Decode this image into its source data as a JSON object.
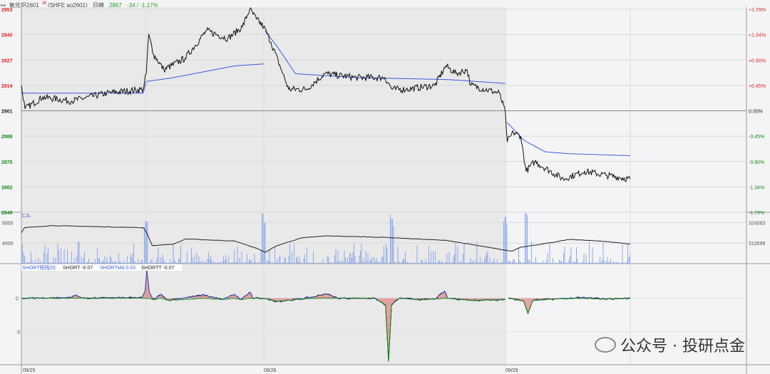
{
  "header": {
    "link_icon": "link-icon",
    "title": "氧化铝2601",
    "superscript": "M",
    "exchange": "(SHFE ao2601)",
    "period": "日線",
    "price": "2867",
    "change": "-34 / -1.17%"
  },
  "volume_pane": {
    "label": "CJL",
    "left_ticks": [
      "8000",
      "4000"
    ],
    "right_ticks": [
      "324083",
      "313599"
    ]
  },
  "indicator_pane": {
    "name": "SHORT短线(5)",
    "short": "SHORT -0.07",
    "shortma": "SHORTMA 0.03",
    "shortt": "SHORTT -0.07",
    "ticks": [
      "0",
      "-5"
    ]
  },
  "dates": [
    "09/25",
    "09/26",
    "09/29"
  ],
  "watermark": "公众号 · 投研点金",
  "colors": {
    "up": "#e02020",
    "down": "#1a8a1a",
    "vwap": "#3b5bdb",
    "price": "#111111",
    "volume": "#8fa8e8"
  },
  "chart_data": {
    "type": "line",
    "title": "氧化铝2601 intraday",
    "ylim": [
      2849,
      2953
    ],
    "left_ticks": [
      "2953",
      "2940",
      "2927",
      "2914",
      "2901",
      "2888",
      "2875",
      "2862",
      "2849"
    ],
    "right_ticks": [
      "+1.79%",
      "+1.34%",
      "+0.90%",
      "+0.45%",
      "0.00%",
      "-0.45%",
      "-0.90%",
      "-1.34%",
      "-1.79%"
    ],
    "prev_close": 2901,
    "price": [
      [
        0,
        2914
      ],
      [
        0.6,
        2902
      ],
      [
        3.5,
        2908
      ],
      [
        8.2,
        2906
      ],
      [
        14,
        2910
      ],
      [
        20,
        2912
      ],
      [
        20.5,
        2920
      ],
      [
        20.9,
        2940
      ],
      [
        21.7,
        2930
      ],
      [
        23.4,
        2922
      ],
      [
        26.9,
        2928
      ],
      [
        30.4,
        2942
      ],
      [
        33.9,
        2938
      ],
      [
        36.3,
        2944
      ],
      [
        37.5,
        2953
      ],
      [
        38.6,
        2948
      ],
      [
        39.8,
        2944
      ],
      [
        41,
        2936
      ],
      [
        42.7,
        2922
      ],
      [
        43.9,
        2912
      ],
      [
        46.8,
        2912
      ],
      [
        49.8,
        2920
      ],
      [
        55,
        2918
      ],
      [
        59.7,
        2918
      ],
      [
        60.9,
        2912
      ],
      [
        63.2,
        2912
      ],
      [
        67.9,
        2914
      ],
      [
        69.7,
        2924
      ],
      [
        71.4,
        2920
      ],
      [
        73.2,
        2922
      ],
      [
        73.8,
        2914
      ],
      [
        78.5,
        2910
      ],
      [
        79.5,
        2900
      ],
      [
        79.8,
        2885
      ],
      [
        80.8,
        2890
      ],
      [
        82,
        2888
      ],
      [
        82.9,
        2870
      ],
      [
        84.3,
        2875
      ],
      [
        89,
        2866
      ],
      [
        92.5,
        2870
      ],
      [
        96,
        2868
      ],
      [
        100,
        2866
      ]
    ],
    "vwap": [
      [
        [
          0,
          2910
        ],
        [
          20,
          2910
        ],
        [
          20.5,
          2916
        ],
        [
          25,
          2918
        ],
        [
          35,
          2924
        ],
        [
          39.8,
          2925
        ]
      ],
      [
        [
          40,
          2942
        ],
        [
          42,
          2934
        ],
        [
          45,
          2920
        ],
        [
          55,
          2918
        ],
        [
          70,
          2917
        ],
        [
          79.5,
          2915
        ]
      ],
      [
        [
          79.8,
          2895
        ],
        [
          82.5,
          2886
        ],
        [
          86,
          2880
        ],
        [
          90,
          2879
        ],
        [
          100,
          2878
        ]
      ]
    ],
    "oi": [
      [
        0,
        6000
      ],
      [
        0.5,
        7000
      ],
      [
        5,
        7400
      ],
      [
        20,
        7000
      ],
      [
        20.6,
        6000
      ],
      [
        21.5,
        3500
      ],
      [
        25,
        3800
      ],
      [
        27,
        4800
      ],
      [
        35,
        4400
      ],
      [
        38.6,
        3000
      ],
      [
        40,
        2200
      ],
      [
        42,
        3500
      ],
      [
        46,
        5000
      ],
      [
        50,
        5400
      ],
      [
        60,
        5100
      ],
      [
        70,
        4500
      ],
      [
        79.5,
        2600
      ],
      [
        80.5,
        2400
      ],
      [
        82,
        3200
      ],
      [
        86,
        3900
      ],
      [
        90,
        4700
      ],
      [
        95,
        4400
      ],
      [
        100,
        3800
      ]
    ],
    "oi_ylim": [
      0,
      10000
    ],
    "short": [
      [
        0,
        0
      ],
      [
        8,
        0.1
      ],
      [
        9,
        0.5
      ],
      [
        10,
        0
      ],
      [
        19.8,
        0.1
      ],
      [
        20.3,
        1
      ],
      [
        20.6,
        4.2
      ],
      [
        21,
        1
      ],
      [
        21.6,
        -0.2
      ],
      [
        23,
        0.6
      ],
      [
        24,
        -0.3
      ],
      [
        30,
        0.5
      ],
      [
        33,
        -0.2
      ],
      [
        35,
        0.6
      ],
      [
        36,
        -0.2
      ],
      [
        37.6,
        0.9
      ],
      [
        38,
        0
      ],
      [
        39.8,
        0
      ],
      [
        42,
        -0.5
      ],
      [
        44,
        -0.3
      ],
      [
        48,
        0.2
      ],
      [
        50,
        0.7
      ],
      [
        52,
        0
      ],
      [
        58,
        0
      ],
      [
        59.8,
        -1
      ],
      [
        60.3,
        -9.5
      ],
      [
        60.8,
        -1
      ],
      [
        62,
        0
      ],
      [
        66,
        -0.2
      ],
      [
        68,
        -0.1
      ],
      [
        69.5,
        1.1
      ],
      [
        70,
        0
      ],
      [
        74,
        -0.3
      ],
      [
        79.5,
        -0.2
      ]
    ],
    "short2": [
      [
        80,
        0
      ],
      [
        82.5,
        -0.4
      ],
      [
        83.2,
        -2.3
      ],
      [
        84,
        -0.3
      ],
      [
        88,
        -0.1
      ],
      [
        92,
        0.1
      ],
      [
        96,
        -0.1
      ],
      [
        100,
        0
      ]
    ],
    "short_ylim": [
      -10,
      5
    ]
  }
}
